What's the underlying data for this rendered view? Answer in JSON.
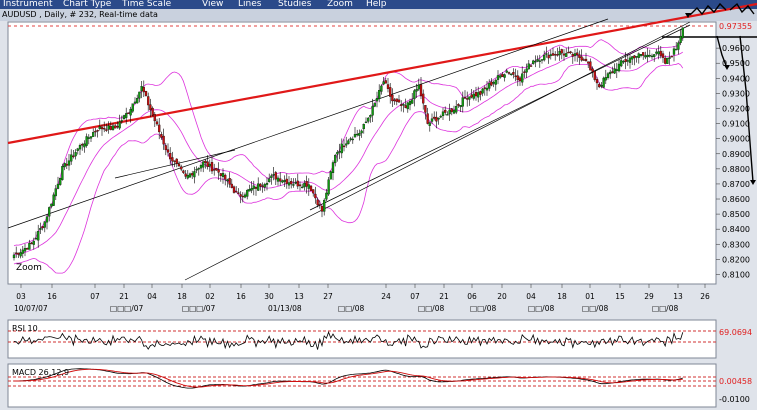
{
  "menu": {
    "items": [
      {
        "label": "Instrument"
      },
      {
        "label": "Chart Type"
      },
      {
        "label": "Time Scale"
      },
      {
        "label": "View"
      },
      {
        "label": "Lines"
      },
      {
        "label": "Studies"
      },
      {
        "label": "Zoom"
      },
      {
        "label": "Help"
      }
    ]
  },
  "header": {
    "title": "AUDUSD , Daily, # 232, Real-time data"
  },
  "zoom_label": "Zoom",
  "price_panel": {
    "last_price": "0.97355",
    "y_ticks": [
      "0.9600",
      "0.9500",
      "0.9400",
      "0.9300",
      "0.9200",
      "0.9100",
      "0.9000",
      "0.8900",
      "0.8800",
      "0.8700",
      "0.8600",
      "0.8500",
      "0.8400",
      "0.8300",
      "0.8200",
      "0.8100"
    ]
  },
  "x_axis": {
    "day_labels": [
      "03",
      "16",
      "07",
      "21",
      "04",
      "18",
      "02",
      "16",
      "30",
      "13",
      "27",
      "24",
      "07",
      "21",
      "06",
      "20",
      "04",
      "18",
      "01",
      "15",
      "29",
      "13",
      "26"
    ],
    "month_labels": [
      "10/07/07",
      "□□□/07",
      "□□□/07",
      "01/13/08",
      "□□/08",
      "□□/08",
      "□□/08",
      "□□/08",
      "□□/08",
      "□□/08"
    ]
  },
  "rsi_panel": {
    "label": "RSI 10",
    "value": "69.0694"
  },
  "macd_panel": {
    "label": "MACD 26,12,9",
    "value": "0.00458",
    "lower_value": "-0.0100"
  },
  "chart_data": {
    "type": "candlestick",
    "instrument": "AUDUSD",
    "timeframe": "Daily",
    "y_range": [
      0.805,
      0.976
    ],
    "last_close": 0.97355,
    "anchor_closes": [
      [
        0,
        0.823
      ],
      [
        8,
        0.83
      ],
      [
        14,
        0.845
      ],
      [
        22,
        0.88
      ],
      [
        30,
        0.895
      ],
      [
        38,
        0.907
      ],
      [
        46,
        0.907
      ],
      [
        52,
        0.918
      ],
      [
        58,
        0.934
      ],
      [
        64,
        0.912
      ],
      [
        70,
        0.89
      ],
      [
        78,
        0.874
      ],
      [
        86,
        0.884
      ],
      [
        94,
        0.877
      ],
      [
        102,
        0.862
      ],
      [
        110,
        0.868
      ],
      [
        118,
        0.875
      ],
      [
        128,
        0.87
      ],
      [
        134,
        0.87
      ],
      [
        140,
        0.852
      ],
      [
        146,
        0.89
      ],
      [
        152,
        0.9
      ],
      [
        158,
        0.905
      ],
      [
        164,
        0.923
      ],
      [
        168,
        0.938
      ],
      [
        172,
        0.925
      ],
      [
        178,
        0.92
      ],
      [
        184,
        0.935
      ],
      [
        188,
        0.91
      ],
      [
        194,
        0.915
      ],
      [
        200,
        0.92
      ],
      [
        206,
        0.928
      ],
      [
        212,
        0.93
      ],
      [
        218,
        0.938
      ],
      [
        224,
        0.945
      ],
      [
        230,
        0.94
      ],
      [
        236,
        0.952
      ],
      [
        242,
        0.955
      ],
      [
        248,
        0.957
      ],
      [
        254,
        0.955
      ],
      [
        260,
        0.953
      ],
      [
        262,
        0.945
      ],
      [
        266,
        0.935
      ],
      [
        270,
        0.942
      ],
      [
        276,
        0.95
      ],
      [
        282,
        0.955
      ],
      [
        288,
        0.955
      ],
      [
        292,
        0.958
      ],
      [
        296,
        0.95
      ],
      [
        301,
        0.96
      ],
      [
        304,
        0.97355
      ]
    ],
    "overlays": [
      "Bollinger Bands",
      "Trend lines",
      "Price channel"
    ],
    "indicators": [
      {
        "name": "RSI 10",
        "last": 69.0694,
        "levels": [
          30,
          70
        ]
      },
      {
        "name": "MACD 26,12,9",
        "last": 0.00458
      }
    ]
  },
  "colors": {
    "candle_up": "#119911",
    "candle_down": "#c01010",
    "bollinger": "#dd33dd",
    "trendline_red": "#e01818",
    "panel_bg": "#ffffff",
    "frame_bg": "#dfe3ea",
    "menubar": "#2b4a8a"
  }
}
